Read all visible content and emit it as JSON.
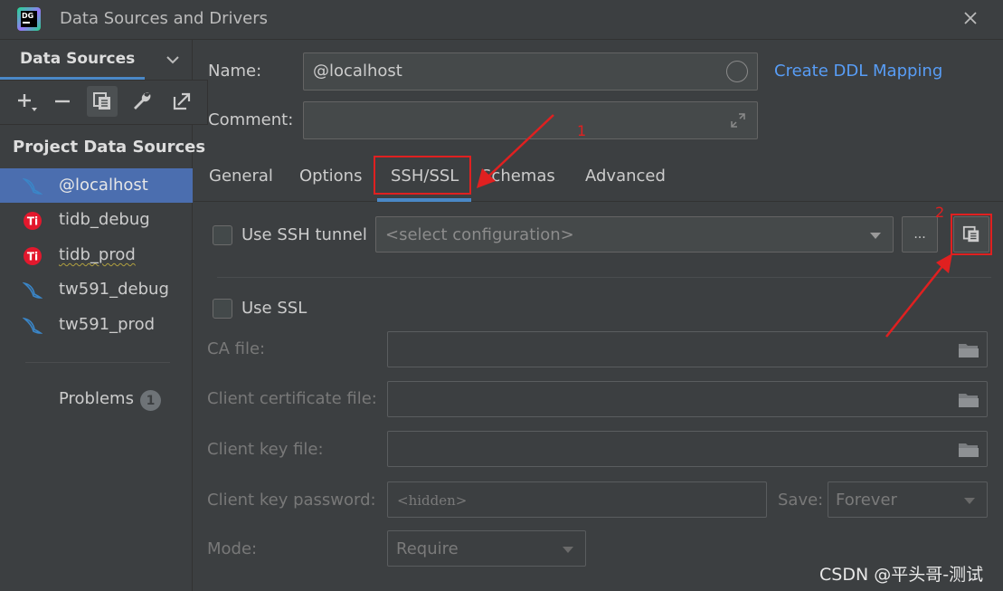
{
  "window": {
    "title": "Data Sources and Drivers",
    "logo_text": "DG"
  },
  "sidebar": {
    "header_label": "Data Sources",
    "section_label": "Project Data Sources",
    "items": [
      {
        "label": "@localhost",
        "icon": "mysql-dolphin-icon",
        "selected": true
      },
      {
        "label": "tidb_debug",
        "icon": "tidb-icon",
        "selected": false
      },
      {
        "label": "tidb_prod",
        "icon": "tidb-icon",
        "selected": false
      },
      {
        "label": "tw591_debug",
        "icon": "mysql-dolphin-icon",
        "selected": false
      },
      {
        "label": "tw591_prod",
        "icon": "mysql-dolphin-icon",
        "selected": false
      }
    ],
    "problems_label": "Problems",
    "problems_count": "1"
  },
  "form": {
    "name_label": "Name:",
    "name_value": "@localhost",
    "comment_label": "Comment:",
    "comment_value": "",
    "ddl_link": "Create DDL Mapping"
  },
  "tabs": [
    {
      "label": "General"
    },
    {
      "label": "Options"
    },
    {
      "label": "SSH/SSL",
      "active": true
    },
    {
      "label": "Schemas"
    },
    {
      "label": "Advanced"
    }
  ],
  "ssh": {
    "use_label": "Use SSH tunnel",
    "config_placeholder": "<select configuration>",
    "more_label": "..."
  },
  "ssl": {
    "use_label": "Use SSL",
    "ca_label": "CA file:",
    "cert_label": "Client certificate file:",
    "key_label": "Client key file:",
    "password_label": "Client key password:",
    "password_value": "<hidden>",
    "save_label": "Save:",
    "save_value": "Forever",
    "mode_label": "Mode:",
    "mode_value": "Require"
  },
  "annotations": {
    "one": "1",
    "two": "2"
  },
  "watermark": "CSDN @平头哥-测试",
  "colors": {
    "accent": "#4a88c7",
    "selection": "#4b6eaf",
    "link": "#589df6",
    "annotation": "#e02020"
  }
}
